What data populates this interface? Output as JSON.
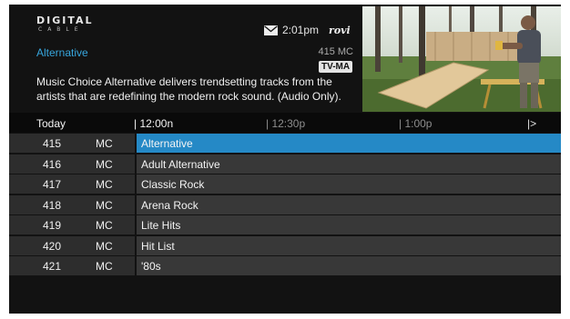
{
  "header": {
    "logo_top": "DIGITAL",
    "logo_bottom": "CABLE",
    "time": "2:01pm",
    "brand": "rovi",
    "icons": {
      "mail": "envelope-icon"
    }
  },
  "program": {
    "title": "Alternative",
    "channel": "415 MC",
    "rating": "TV-MA",
    "description": "Music Choice Alternative delivers trendsetting tracks from the artists that are redefining the modern rock sound. (Audio Only)."
  },
  "timeline": {
    "day": "Today",
    "slots": [
      "| 12:00n",
      "| 12:30p",
      "| 1:00p"
    ],
    "next": "|>"
  },
  "rows": [
    {
      "number": "415",
      "network": "MC",
      "show": "Alternative"
    },
    {
      "number": "416",
      "network": "MC",
      "show": "Adult Alternative"
    },
    {
      "number": "417",
      "network": "MC",
      "show": "Classic Rock"
    },
    {
      "number": "418",
      "network": "MC",
      "show": "Arena Rock"
    },
    {
      "number": "419",
      "network": "MC",
      "show": "Lite Hits"
    },
    {
      "number": "420",
      "network": "MC",
      "show": "Hit List"
    },
    {
      "number": "421",
      "network": "MC",
      "show": "'80s"
    }
  ],
  "colors": {
    "accent": "#37a6dd",
    "selected_row": "#2589c6",
    "background": "#121212"
  }
}
